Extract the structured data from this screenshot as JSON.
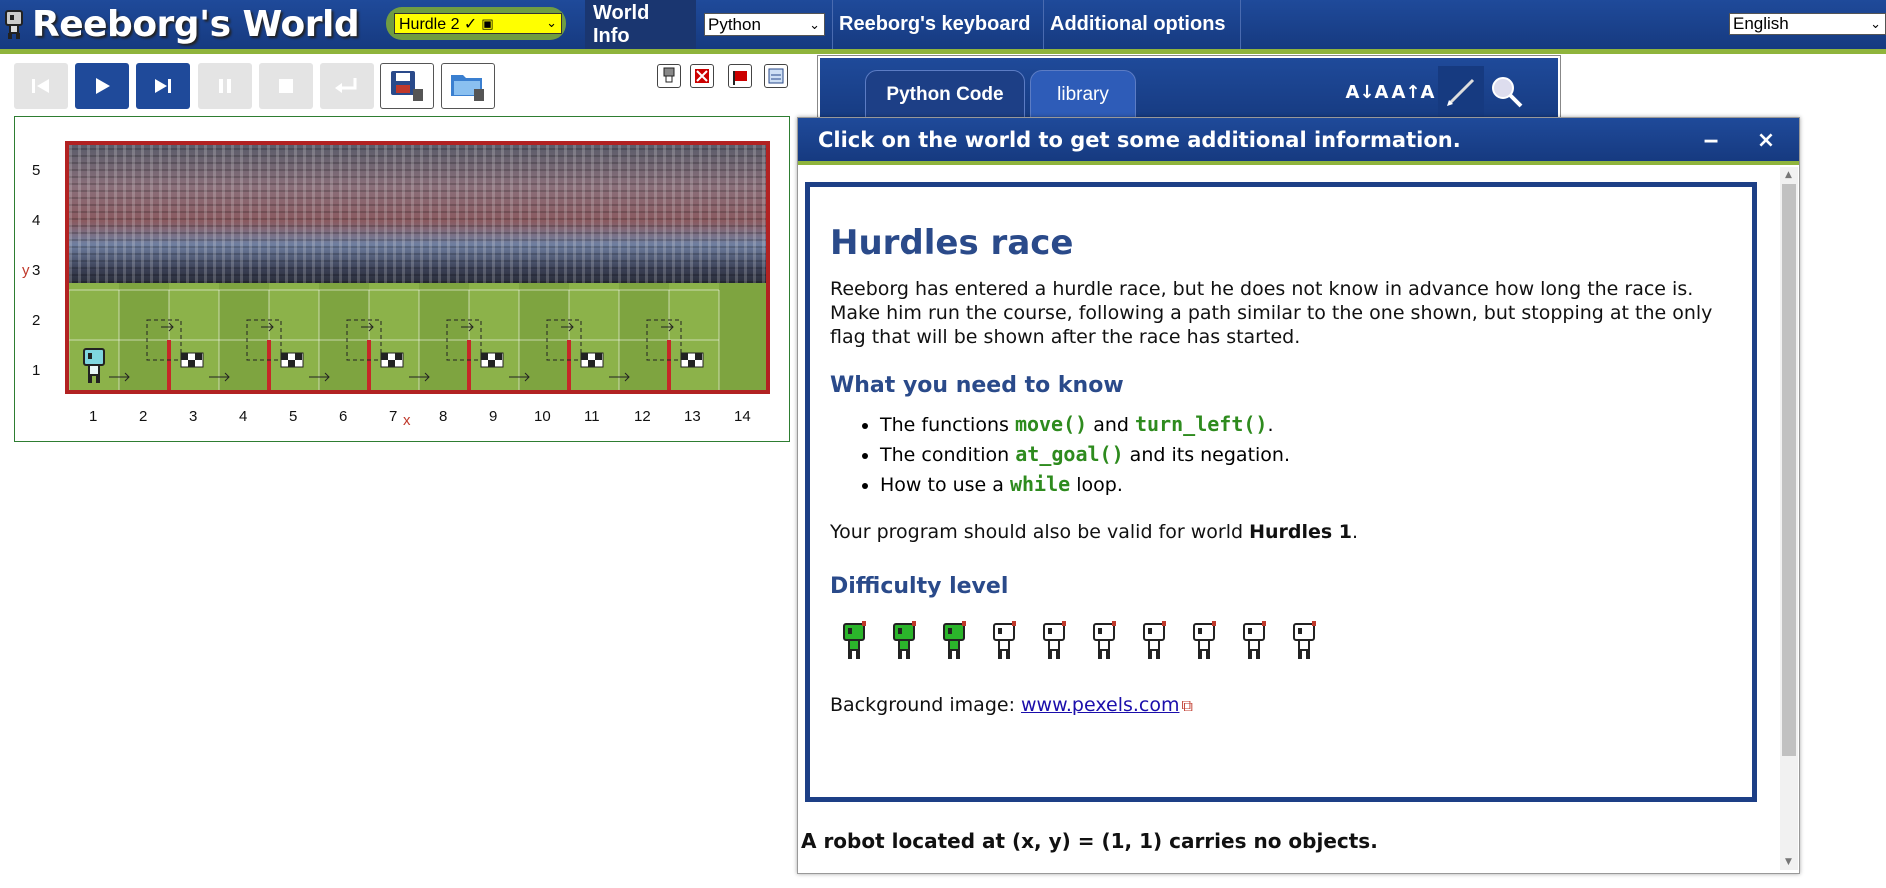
{
  "header": {
    "title": "Reeborg's World",
    "world_select": "Hurdle 2 ✓",
    "language_select": "Python",
    "menu": {
      "world_info": "World Info",
      "keyboard": "Reeborg's keyboard",
      "additional_options": "Additional options"
    },
    "ui_language": "English"
  },
  "toolbar": {
    "buttons": [
      "reverse-step",
      "run",
      "step",
      "pause",
      "stop",
      "reload"
    ],
    "file_buttons": [
      "save",
      "open"
    ]
  },
  "world": {
    "x_ticks": [
      "1",
      "2",
      "3",
      "4",
      "5",
      "6",
      "7",
      "8",
      "9",
      "10",
      "11",
      "12",
      "13",
      "14"
    ],
    "y_ticks": [
      "5",
      "4",
      "3",
      "2",
      "1"
    ],
    "x_letter": "x",
    "y_letter": "y"
  },
  "editor": {
    "tabs": [
      "Python Code",
      "library"
    ]
  },
  "dialog": {
    "title": "Click on the world to get some additional information.",
    "heading": "Hurdles race",
    "intro": "Reeborg has entered a hurdle race, but he does not know in advance how long the race is. Make him run the course, following a path similar to the one shown, but stopping at the only flag that will be shown after the race has started.",
    "know_heading": "What you need to know",
    "li1_pre": "The functions ",
    "li1_code1": "move()",
    "li1_mid": " and ",
    "li1_code2": "turn_left()",
    "li1_post": ".",
    "li2_pre": "The condition ",
    "li2_code": "at_goal()",
    "li2_post": " and its negation.",
    "li3_pre": "How to use a ",
    "li3_code": "while",
    "li3_post": " loop.",
    "valid_pre": "Your program should also be valid for world ",
    "valid_bold": "Hurdles 1",
    "valid_post": ".",
    "difficulty_heading": "Difficulty level",
    "difficulty": 3,
    "difficulty_max": 10,
    "bg_label": "Background image: ",
    "bg_link": "www.pexels.com",
    "robot_status": "A robot located at (x, y) = (1, 1) carries no objects."
  },
  "colors": {
    "nav_blue": "#1f4a9a",
    "accent_green": "#8fb43c",
    "world_border": "#b22222",
    "heading_blue": "#2a4a8a",
    "code_green": "#2e8b1e"
  }
}
